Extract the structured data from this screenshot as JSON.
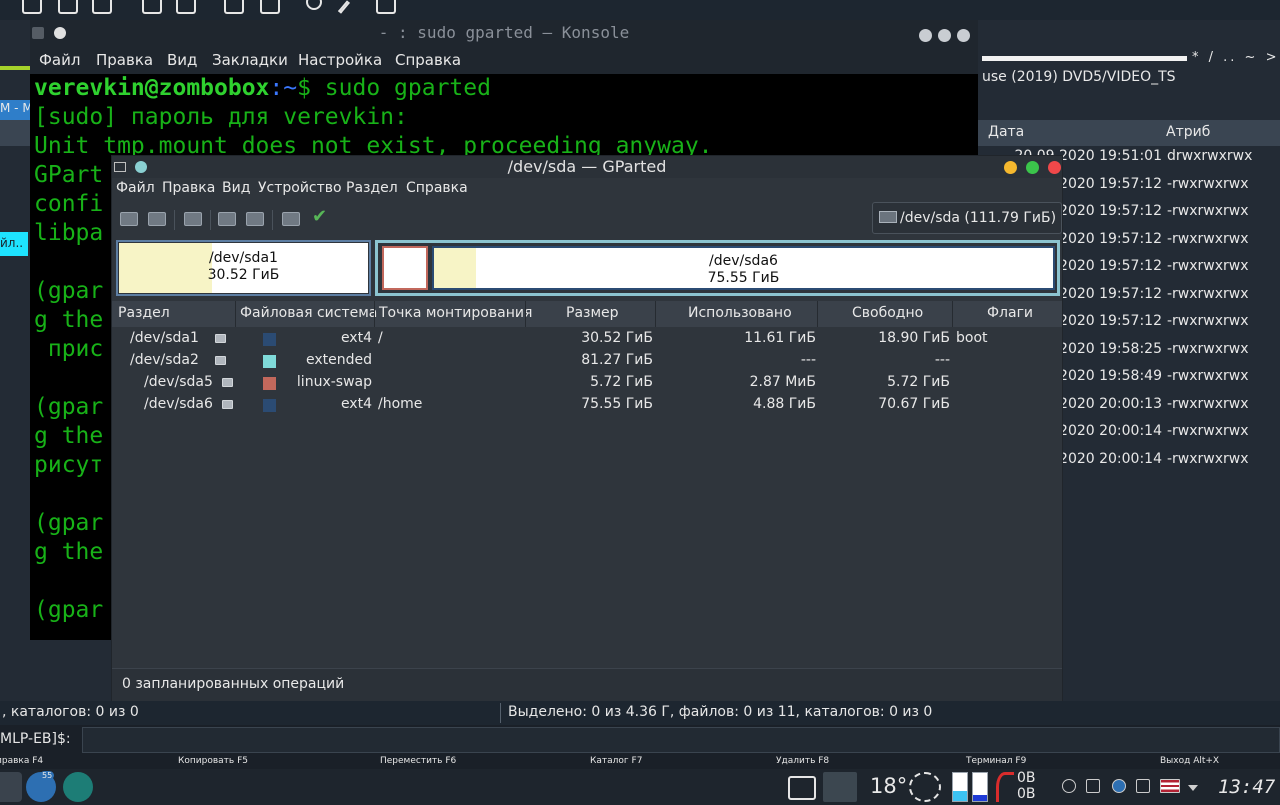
{
  "konsole": {
    "title": "- : sudo gparted — Konsole",
    "menu": [
      "Файл",
      "Правка",
      "Вид",
      "Закладки",
      "Настройка",
      "Справка"
    ],
    "prompt_user": "verevkin@zombobox",
    "prompt_path": ":~",
    "prompt_cmd": "$ sudo gparted",
    "lines": [
      "[sudo] пароль для verevkin:",
      "Unit tmp.mount does not exist, proceeding anyway.",
      "GPart",
      "confi",
      "libpa",
      "",
      "(gpar",
      "g the",
      " прис",
      "",
      "(gpar",
      "g the",
      "рисут",
      "",
      "(gpar",
      "g the",
      "",
      "(gpar"
    ]
  },
  "file_manager": {
    "path": "use (2019) DVD5/VIDEO_TS",
    "nav_marks": "* / .. ~ >",
    "col_date": "Дата",
    "col_attr": "Атриб",
    "left_tab": "M - M",
    "left_cyan": "йл..",
    "rows": [
      {
        "date": "20.09.2020 19:51:01",
        "attr": "drwxrwxrwx"
      },
      {
        "date": "2020 19:57:12",
        "attr": "-rwxrwxrwx"
      },
      {
        "date": "2020 19:57:12",
        "attr": "-rwxrwxrwx"
      },
      {
        "date": "2020 19:57:12",
        "attr": "-rwxrwxrwx"
      },
      {
        "date": "2020 19:57:12",
        "attr": "-rwxrwxrwx"
      },
      {
        "date": "2020 19:57:12",
        "attr": "-rwxrwxrwx"
      },
      {
        "date": "2020 19:57:12",
        "attr": "-rwxrwxrwx"
      },
      {
        "date": "2020 19:58:25",
        "attr": "-rwxrwxrwx"
      },
      {
        "date": "2020 19:58:49",
        "attr": "-rwxrwxrwx"
      },
      {
        "date": "2020 20:00:13",
        "attr": "-rwxrwxrwx"
      },
      {
        "date": "2020 20:00:14",
        "attr": "-rwxrwxrwx"
      },
      {
        "date": "2020 20:00:14",
        "attr": "-rwxrwxrwx"
      }
    ],
    "status_left": ", каталогов: 0 из 0",
    "status_right": "Выделено: 0 из 4.36 Г, файлов: 0 из 11, каталогов: 0 из 0",
    "cmd_prompt": "MLP-EB]$:",
    "fkeys": [
      "правка F4",
      "Копировать F5",
      "Переместить F6",
      "Каталог F7",
      "Удалить F8",
      "Терминал F9",
      "Выход Alt+X"
    ]
  },
  "gparted": {
    "title": "/dev/sda — GParted",
    "menu": [
      "Файл",
      "Правка",
      "Вид",
      "Устройство",
      "Раздел",
      "Справка"
    ],
    "device": "/dev/sda (111.79 ГиБ)",
    "map": {
      "sda1_name": "/dev/sda1",
      "sda1_size": "30.52 ГиБ",
      "sda6_name": "/dev/sda6",
      "sda6_size": "75.55 ГиБ"
    },
    "columns": [
      "Раздел",
      "Файловая система",
      "Точка монтирования",
      "Размер",
      "Использовано",
      "Свободно",
      "Флаги"
    ],
    "rows": [
      {
        "part": "/dev/sda1",
        "fs": "ext4",
        "mount": "/",
        "size": "30.52 ГиБ",
        "used": "11.61 ГиБ",
        "free": "18.90 ГиБ",
        "flags": "boot",
        "color": "#2b4b73"
      },
      {
        "part": "/dev/sda2",
        "fs": "extended",
        "mount": "",
        "size": "81.27 ГиБ",
        "used": "---",
        "free": "---",
        "flags": "",
        "color": "#7fdad9"
      },
      {
        "part": "/dev/sda5",
        "fs": "linux-swap",
        "mount": "",
        "size": "5.72 ГиБ",
        "used": "2.87 МиБ",
        "free": "5.72 ГиБ",
        "flags": "",
        "color": "#c2685c"
      },
      {
        "part": "/dev/sda6",
        "fs": "ext4",
        "mount": "/home",
        "size": "75.55 ГиБ",
        "used": "4.88 ГиБ",
        "free": "70.67 ГиБ",
        "flags": "",
        "color": "#2b4b73"
      }
    ],
    "status": "0 запланированных операций"
  },
  "taskbar": {
    "temperature": "18°",
    "net_up": "0B",
    "net_down": "0B",
    "clock": "13:47",
    "badge": "55"
  },
  "colors": {
    "term_green": "#18b218",
    "term_user": "#2fd12f",
    "swap": "#c2685c",
    "ext4": "#2b4b73",
    "extended": "#7fdad9"
  }
}
